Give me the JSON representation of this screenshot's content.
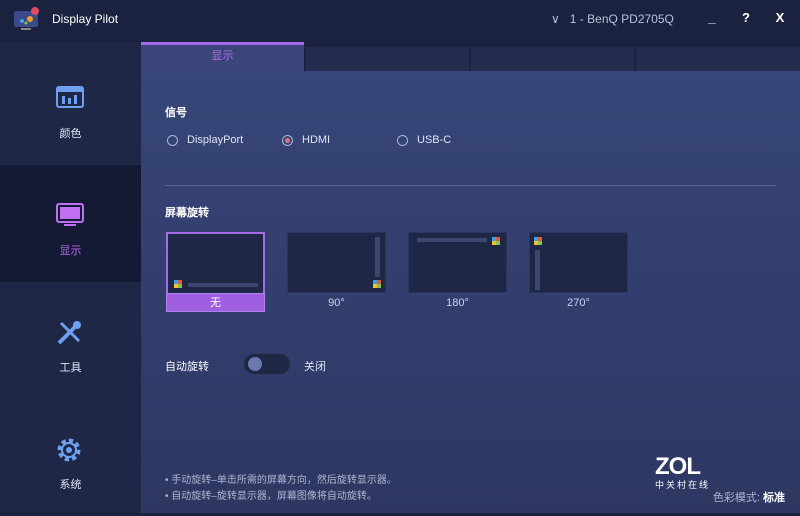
{
  "app": {
    "title": "Display Pilot",
    "monitor": "1 - BenQ PD2705Q",
    "minimize": "_",
    "help": "?",
    "close": "X"
  },
  "sidebar": {
    "items": [
      {
        "label": "颜色"
      },
      {
        "label": "显示"
      },
      {
        "label": "工具"
      },
      {
        "label": "系统"
      }
    ]
  },
  "tabs": [
    {
      "label": "显示"
    },
    {
      "label": ""
    },
    {
      "label": ""
    },
    {
      "label": ""
    }
  ],
  "signal": {
    "title": "信号",
    "options": [
      "DisplayPort",
      "HDMI",
      "USB-C"
    ],
    "selected": "HDMI"
  },
  "rotation": {
    "title": "屏幕旋转",
    "options": [
      "无",
      "90°",
      "180°",
      "270°"
    ],
    "selected": "无"
  },
  "auto_rotate": {
    "label": "自动旋转",
    "state": "关闭",
    "on": false
  },
  "notes": [
    "• 手动旋转–单击所需的屏幕方向，然后旋转显示器。",
    "• 自动旋转–旋转显示器，屏幕图像将自动旋转。"
  ],
  "watermark": {
    "brand": "ZOL",
    "sub": "中关村在线"
  },
  "color_mode": {
    "label": "色彩模式:",
    "value": "标准"
  }
}
